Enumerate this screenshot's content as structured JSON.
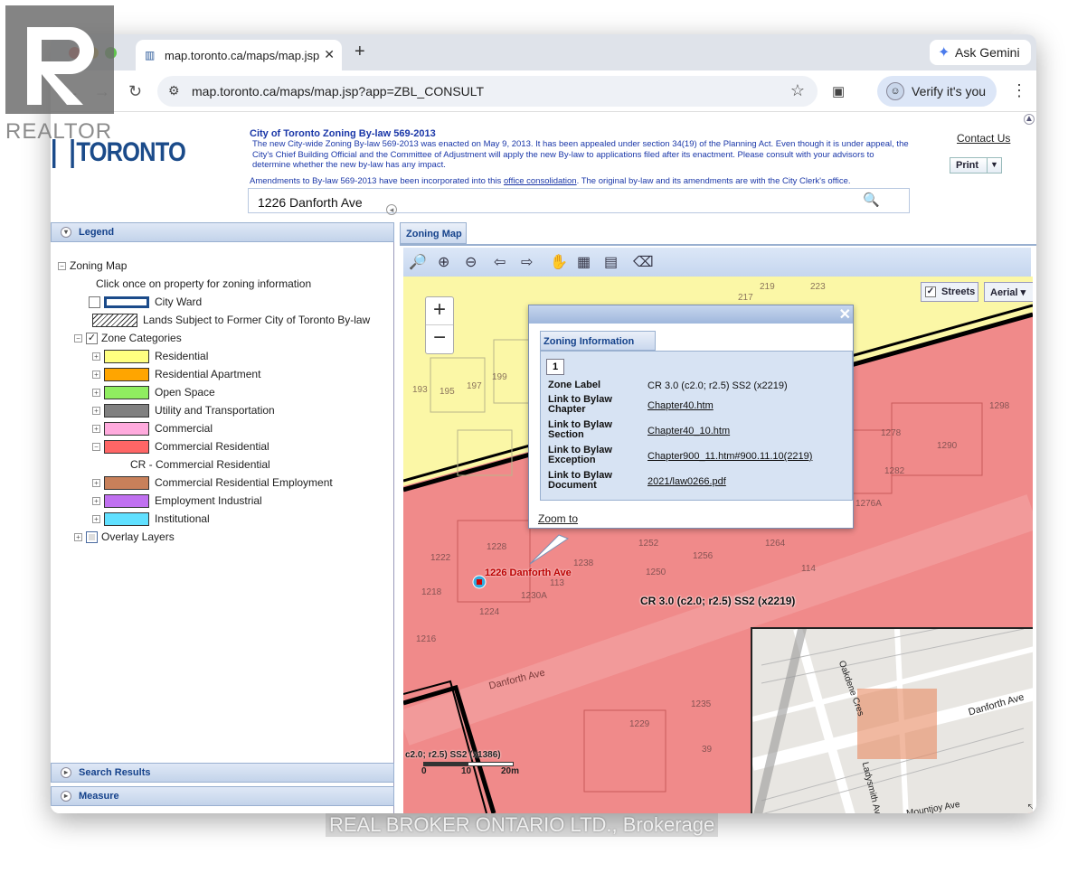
{
  "browser": {
    "tab_title": "map.toronto.ca/maps/map.jsp",
    "url": "map.toronto.ca/maps/map.jsp?app=ZBL_CONSULT",
    "gemini_label": "Ask Gemini",
    "verify_label": "Verify it's you"
  },
  "header": {
    "logo_text": "TORONTO",
    "title": "City of Toronto Zoning By-law 569-2013",
    "para1": "The new City-wide Zoning By-law 569-2013 was enacted on May 9, 2013. It has been appealed under section 34(19) of the Planning Act. Even though it is under appeal, the City's Chief Building Official and the Committee of Adjustment will apply the new By-law to applications filed after its enactment. Please consult with your advisors to determine whether the new by-law has any impact.",
    "para2_a": "Amendments to By-law 569-2013 have been incorporated into this ",
    "para2_link": "office consolidation",
    "para2_b": ". The original by-law and its amendments  are with the City Clerk's office.",
    "search_value": "1226 Danforth Ave",
    "contact_label": "Contact Us",
    "print_label": "Print"
  },
  "legend": {
    "title": "Legend",
    "root": "Zoning Map",
    "hint": "Click once on property for zoning information",
    "city_ward": "City Ward",
    "lands_subject": "Lands Subject to Former City of Toronto By-law",
    "zone_categories": "Zone Categories",
    "zones": [
      {
        "label": "Residential",
        "color": "#ffff80"
      },
      {
        "label": "Residential Apartment",
        "color": "#ffa500"
      },
      {
        "label": "Open Space",
        "color": "#90ee60"
      },
      {
        "label": "Utility and Transportation",
        "color": "#808080"
      },
      {
        "label": "Commercial",
        "color": "#ffaadd"
      },
      {
        "label": "Commercial Residential",
        "color": "#ff6666"
      },
      {
        "label": "Commercial Residential Employment",
        "color": "#c8805a"
      },
      {
        "label": "Employment Industrial",
        "color": "#c070f0"
      },
      {
        "label": "Institutional",
        "color": "#60e0ff"
      }
    ],
    "cr_sub": "CR - Commercial Residential",
    "overlay": "Overlay Layers"
  },
  "footer_panels": {
    "search_results": "Search Results",
    "measure": "Measure"
  },
  "map": {
    "tab_label": "Zoning Map",
    "streets_label": "Streets",
    "aerial_label": "Aerial",
    "marker_label": "1226 Danforth Ave",
    "zone_label_on_map": "CR 3.0 (c2.0; r2.5) SS2  (x2219)",
    "street_name": "Danforth Ave",
    "partial_zone_label": "c2.0; r2.5) SS2 (x1386)",
    "scale": [
      "0",
      "10",
      "20m"
    ],
    "inset_streets": [
      "Oakdene Cres",
      "Danforth Ave",
      "Ladysmith Ave",
      "Mountjoy Ave"
    ],
    "lot_numbers": [
      "217",
      "219",
      "223",
      "193",
      "195",
      "197",
      "199",
      "1298",
      "1290",
      "1282",
      "1276A",
      "1278",
      "1222",
      "1228",
      "1238",
      "1252",
      "1256",
      "1264",
      "1250",
      "1218",
      "1230A",
      "1224",
      "1216",
      "1235",
      "1229",
      "39",
      "114",
      "113"
    ]
  },
  "popup": {
    "tab": "Zoning Information",
    "record": "1",
    "rows": [
      {
        "label": "Zone Label",
        "value": "CR 3.0 (c2.0; r2.5) SS2 (x2219)"
      },
      {
        "label": "Link to Bylaw Chapter",
        "value": "Chapter40.htm"
      },
      {
        "label": "Link to Bylaw Section",
        "value": "Chapter40_10.htm"
      },
      {
        "label": "Link to Bylaw Exception",
        "value": "Chapter900_11.htm#900.11.10(2219)"
      },
      {
        "label": "Link to Bylaw Document",
        "value": "2021/law0266.pdf"
      }
    ],
    "zoom_to": "Zoom to"
  },
  "watermark": {
    "brand": "REALTOR",
    "brokerage": "REAL BROKER ONTARIO LTD., Brokerage"
  }
}
